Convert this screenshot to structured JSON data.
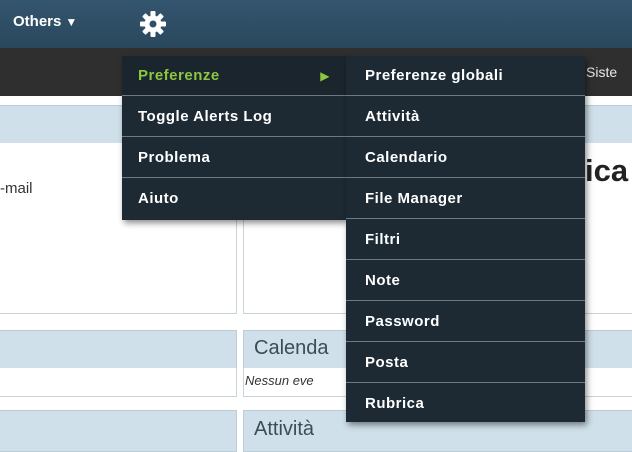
{
  "topbar": {
    "others_label": "Others",
    "others_caret_icon": "caret-down-icon",
    "settings_icon": "gear-icon"
  },
  "subbar": {
    "partial_label": "Siste"
  },
  "background": {
    "email_text": "-mail",
    "heading_partial": "ica",
    "calendar_heading": "Calenda",
    "calendar_empty": "Nessun eve",
    "activity_heading": "Attività"
  },
  "menu": {
    "items": [
      {
        "label": "Preferenze",
        "active": true,
        "has_submenu": true,
        "arrow_icon": "triangle-right-icon"
      },
      {
        "label": "Toggle Alerts Log"
      },
      {
        "label": "Problema"
      },
      {
        "label": "Aiuto"
      }
    ]
  },
  "submenu": {
    "items": [
      {
        "label": "Preferenze globali"
      },
      {
        "label": "Attività"
      },
      {
        "label": "Calendario"
      },
      {
        "label": "File Manager"
      },
      {
        "label": "Filtri"
      },
      {
        "label": "Note"
      },
      {
        "label": "Password"
      },
      {
        "label": "Posta"
      },
      {
        "label": "Rubrica"
      }
    ]
  },
  "colors": {
    "topbar": "#2f4f66",
    "menu_bg": "#1d2a33",
    "active_item": "#8dc63f",
    "panel_header": "#cfe0ea"
  }
}
